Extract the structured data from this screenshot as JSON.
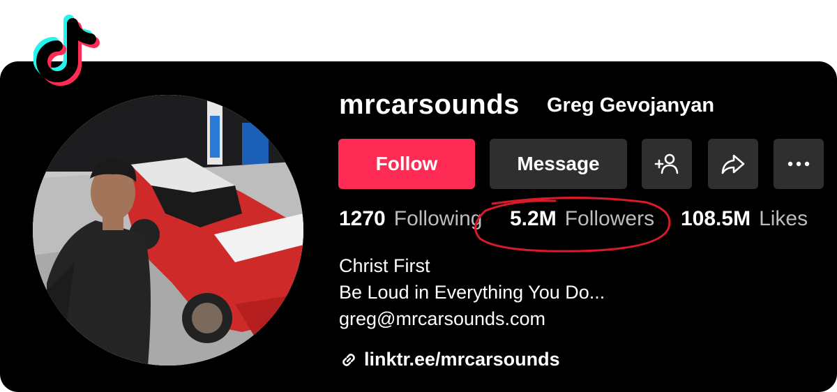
{
  "profile": {
    "username": "mrcarsounds",
    "display_name": "Greg Gevojanyan",
    "avatar_alt": "profile photo"
  },
  "buttons": {
    "follow": "Follow",
    "message": "Message",
    "add_friend_icon": "add-user-icon",
    "share_icon": "share-icon",
    "more_icon": "more-icon"
  },
  "stats": {
    "following_count": "1270",
    "following_label": "Following",
    "followers_count": "5.2M",
    "followers_label": "Followers",
    "likes_count": "108.5M",
    "likes_label": "Likes"
  },
  "bio": {
    "line1": "Christ First",
    "line2": "Be Loud in Everything You Do...",
    "line3": "greg@mrcarsounds.com"
  },
  "link": {
    "text": "linktr.ee/mrcarsounds",
    "icon": "link-icon"
  },
  "colors": {
    "follow_button": "#fe2c55",
    "secondary_button": "#2f2f2f",
    "annotation_circle": "#d91a2a",
    "tiktok_cyan": "#25f4ee",
    "tiktok_red": "#fe2c55"
  }
}
